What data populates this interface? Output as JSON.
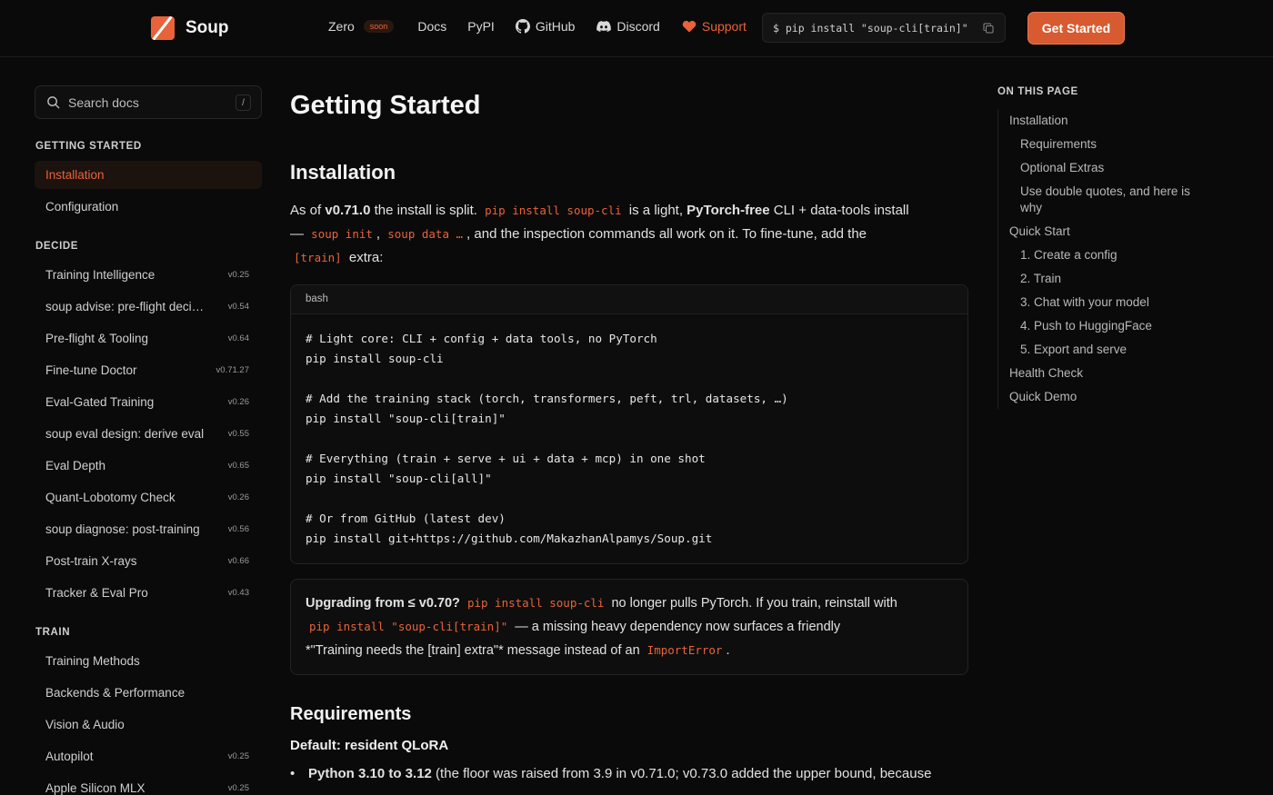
{
  "brand": {
    "name": "Soup"
  },
  "nav": {
    "zero": "Zero",
    "soon": "soon",
    "docs": "Docs",
    "pypi": "PyPI",
    "github": "GitHub",
    "discord": "Discord",
    "support": "Support"
  },
  "install_box": {
    "command": "$ pip install \"soup-cli[train]\""
  },
  "get_started": "Get Started",
  "search": {
    "placeholder": "Search docs",
    "shortcut": "/"
  },
  "sidebar": {
    "sections": [
      {
        "title": "GETTING STARTED",
        "items": [
          {
            "label": "Installation",
            "version": ""
          },
          {
            "label": "Configuration",
            "version": ""
          }
        ]
      },
      {
        "title": "DECIDE",
        "items": [
          {
            "label": "Training Intelligence",
            "version": "v0.25"
          },
          {
            "label": "soup advise: pre-flight decision",
            "version": "v0.54"
          },
          {
            "label": "Pre-flight & Tooling",
            "version": "v0.64"
          },
          {
            "label": "Fine-tune Doctor",
            "version": "v0.71.27"
          },
          {
            "label": "Eval-Gated Training",
            "version": "v0.26"
          },
          {
            "label": "soup eval design: derive eval",
            "version": "v0.55"
          },
          {
            "label": "Eval Depth",
            "version": "v0.65"
          },
          {
            "label": "Quant-Lobotomy Check",
            "version": "v0.26"
          },
          {
            "label": "soup diagnose: post-training",
            "version": "v0.56"
          },
          {
            "label": "Post-train X-rays",
            "version": "v0.66"
          },
          {
            "label": "Tracker & Eval Pro",
            "version": "v0.43"
          }
        ]
      },
      {
        "title": "TRAIN",
        "items": [
          {
            "label": "Training Methods",
            "version": ""
          },
          {
            "label": "Backends & Performance",
            "version": ""
          },
          {
            "label": "Vision & Audio",
            "version": ""
          },
          {
            "label": "Autopilot",
            "version": "v0.25"
          },
          {
            "label": "Apple Silicon MLX",
            "version": "v0.25"
          }
        ]
      }
    ]
  },
  "main": {
    "title": "Getting Started",
    "installation": {
      "heading": "Installation",
      "p1_a": "As of ",
      "p1_version": "v0.71.0",
      "p1_b": " the install is split. ",
      "p1_code1": "pip install soup-cli",
      "p1_c": " is a light, ",
      "p1_bold": "PyTorch-free",
      "p1_d": " CLI + data-tools install",
      "p1_e": "— ",
      "p1_code2": "soup init",
      "p1_f": ", ",
      "p1_code3": "soup data …",
      "p1_g": ", and the inspection commands all work on it. To fine-tune, add the",
      "p1_code4": "[train]",
      "p1_h": " extra:"
    },
    "codeblock": {
      "lang": "bash",
      "lines": [
        "# Light core: CLI + config + data tools, no PyTorch",
        "pip install soup-cli",
        "",
        "# Add the training stack (torch, transformers, peft, trl, datasets, …)",
        "pip install \"soup-cli[train]\"",
        "",
        "# Everything (train + serve + ui + data + mcp) in one shot",
        "pip install \"soup-cli[all]\"",
        "",
        "# Or from GitHub (latest dev)",
        "pip install git+https://github.com/MakazhanAlpamys/Soup.git"
      ]
    },
    "callout": {
      "bold": "Upgrading from ≤ v0.70?",
      "code1": "pip install soup-cli",
      "a": " no longer pulls PyTorch. If you train, reinstall with",
      "code2": "pip install \"soup-cli[train]\"",
      "b": " — a missing heavy dependency now surfaces a friendly",
      "c": "*\"Training needs the [train] extra\"* message instead of an ",
      "code3": "ImportError",
      "d": "."
    },
    "requirements": {
      "heading": "Requirements",
      "subheading": "Default: resident QLoRA",
      "bullet_bold": "Python 3.10 to 3.12",
      "bullet_text": " (the floor was raised from 3.9 in v0.71.0; v0.73.0 added the upper bound, because"
    }
  },
  "toc": {
    "title": "ON THIS PAGE",
    "items": [
      {
        "label": "Installation",
        "level": 1
      },
      {
        "label": "Requirements",
        "level": 2
      },
      {
        "label": "Optional Extras",
        "level": 2
      },
      {
        "label": "Use double quotes, and here is why",
        "level": 2
      },
      {
        "label": "Quick Start",
        "level": 1
      },
      {
        "label": "1. Create a config",
        "level": 2
      },
      {
        "label": "2. Train",
        "level": 2
      },
      {
        "label": "3. Chat with your model",
        "level": 2
      },
      {
        "label": "4. Push to HuggingFace",
        "level": 2
      },
      {
        "label": "5. Export and serve",
        "level": 2
      },
      {
        "label": "Health Check",
        "level": 1
      },
      {
        "label": "Quick Demo",
        "level": 1
      }
    ]
  },
  "colors": {
    "accent": "#e8633a",
    "background": "#0a0a0a"
  }
}
